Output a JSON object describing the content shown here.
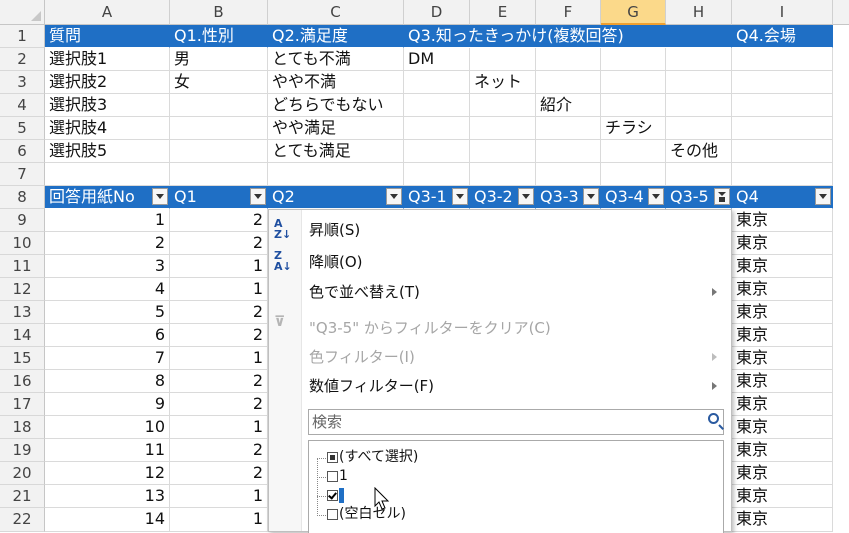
{
  "columns": [
    "A",
    "B",
    "C",
    "D",
    "E",
    "F",
    "G",
    "H",
    "I"
  ],
  "rows": [
    "1",
    "2",
    "3",
    "4",
    "5",
    "6",
    "7",
    "8",
    "9",
    "10",
    "11",
    "12",
    "13",
    "14",
    "15",
    "16",
    "17",
    "18",
    "19",
    "20",
    "21",
    "22"
  ],
  "header_row": {
    "a": "質問",
    "b": "Q1.性別",
    "c": "Q2.満足度",
    "d": "Q3.知ったきっかけ(複数回答)",
    "i": "Q4.会場"
  },
  "choices": [
    {
      "a": "選択肢1",
      "b": "男",
      "c": "とても不満",
      "d": "DM",
      "e": "",
      "f": "",
      "g": "",
      "h": ""
    },
    {
      "a": "選択肢2",
      "b": "女",
      "c": "やや不満",
      "d": "",
      "e": "ネット",
      "f": "",
      "g": "",
      "h": ""
    },
    {
      "a": "選択肢3",
      "b": "",
      "c": "どちらでもない",
      "d": "",
      "e": "",
      "f": "紹介",
      "g": "",
      "h": ""
    },
    {
      "a": "選択肢4",
      "b": "",
      "c": "やや満足",
      "d": "",
      "e": "",
      "f": "",
      "g": "チラシ",
      "h": ""
    },
    {
      "a": "選択肢5",
      "b": "",
      "c": "とても満足",
      "d": "",
      "e": "",
      "f": "",
      "g": "",
      "h": "その他"
    }
  ],
  "table_headers": {
    "a": "回答用紙No",
    "b": "Q1",
    "c": "Q2",
    "d": "Q3-1",
    "e": "Q3-2",
    "f": "Q3-3",
    "g": "Q3-4",
    "h": "Q3-5",
    "i": "Q4"
  },
  "data_rows": [
    {
      "no": "1",
      "q1": "2",
      "q4": "東京"
    },
    {
      "no": "2",
      "q1": "2",
      "q4": "東京"
    },
    {
      "no": "3",
      "q1": "1",
      "q4": "東京"
    },
    {
      "no": "4",
      "q1": "1",
      "q4": "東京"
    },
    {
      "no": "5",
      "q1": "2",
      "q4": "東京"
    },
    {
      "no": "6",
      "q1": "2",
      "q4": "東京"
    },
    {
      "no": "7",
      "q1": "1",
      "q4": "東京"
    },
    {
      "no": "8",
      "q1": "2",
      "q4": "東京"
    },
    {
      "no": "9",
      "q1": "2",
      "q4": "東京"
    },
    {
      "no": "10",
      "q1": "1",
      "q4": "東京"
    },
    {
      "no": "11",
      "q1": "2",
      "q4": "東京"
    },
    {
      "no": "12",
      "q1": "2",
      "q4": "東京"
    },
    {
      "no": "13",
      "q1": "1",
      "q4": "東京"
    },
    {
      "no": "14",
      "q1": "1",
      "q4": "東京"
    }
  ],
  "filter_menu": {
    "sort_asc": "昇順(S)",
    "sort_desc": "降順(O)",
    "sort_color": "色で並べ替え(T)",
    "clear_filter": "\"Q3-5\" からフィルターをクリア(C)",
    "color_filter": "色フィルター(I)",
    "number_filter": "数値フィルター(F)",
    "search_placeholder": "検索",
    "list": {
      "select_all": "(すべて選択)",
      "item1": "1",
      "item2": "",
      "blank": "(空白セル)"
    }
  },
  "colors": {
    "header_blue": "#1f6fc5",
    "selected_col": "#fbd98a"
  }
}
